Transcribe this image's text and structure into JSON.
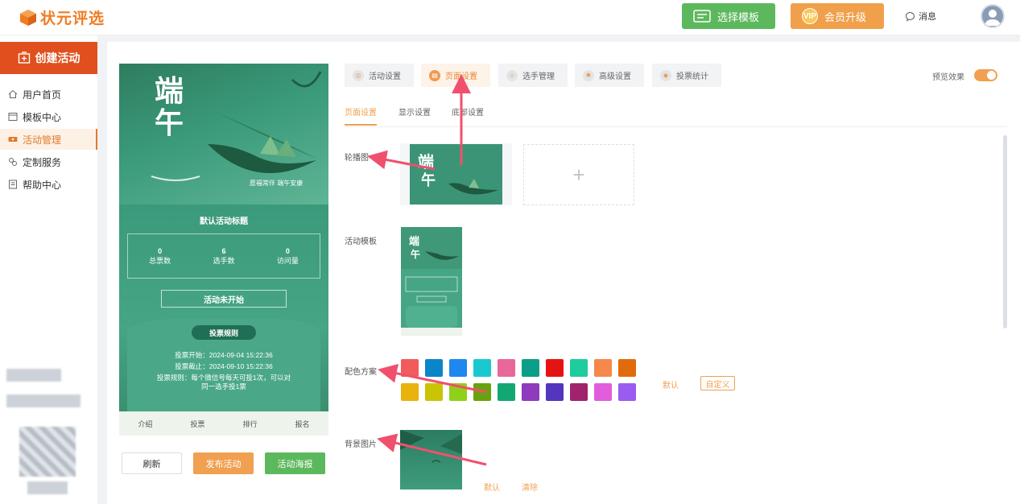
{
  "app": {
    "logo_text": "状元评选"
  },
  "topbar": {
    "select_template": "选择模板",
    "vip_badge": "VIP",
    "vip_upgrade": "会员升级",
    "messages": "消息"
  },
  "sidebar": {
    "create": "创建活动",
    "items": [
      {
        "label": "用户首页",
        "icon": "home-icon"
      },
      {
        "label": "模板中心",
        "icon": "template-icon"
      },
      {
        "label": "活动管理",
        "icon": "ticket-icon",
        "active": true
      },
      {
        "label": "定制服务",
        "icon": "custom-icon"
      },
      {
        "label": "帮助中心",
        "icon": "help-icon"
      }
    ]
  },
  "phone": {
    "calligraphy": "端午",
    "greeting": "愿福常伴 端午安康",
    "title": "默认活动标题",
    "stats": [
      {
        "value": "0",
        "label": "总票数"
      },
      {
        "value": "6",
        "label": "选手数"
      },
      {
        "value": "0",
        "label": "访问量"
      }
    ],
    "status": "活动未开始",
    "rules_title": "投票规则",
    "rules": [
      "投票开始：2024-09-04 15:22:36",
      "投票截止：2024-09-10 15:22:36",
      "投票规则：每个微信号每天可投1次，可以对",
      "同一选手投1票"
    ],
    "nav": [
      "介绍",
      "投票",
      "排行",
      "报名"
    ]
  },
  "actions": {
    "refresh": "刷新",
    "publish": "发布活动",
    "poster": "活动海报"
  },
  "tabs": [
    {
      "label": "活动设置",
      "active": false
    },
    {
      "label": "页面设置",
      "active": true
    },
    {
      "label": "选手管理",
      "active": false
    },
    {
      "label": "高级设置",
      "active": false
    },
    {
      "label": "投票统计",
      "active": false
    }
  ],
  "preview": {
    "label": "预览效果",
    "enabled": true
  },
  "subtabs": [
    {
      "label": "页面设置",
      "active": true
    },
    {
      "label": "显示设置",
      "active": false
    },
    {
      "label": "底部设置",
      "active": false
    }
  ],
  "form": {
    "carousel_label": "轮播图",
    "template_label": "活动模板",
    "scheme_label": "配色方案",
    "bg_label": "背景图片",
    "scheme_default": "默认",
    "scheme_custom": "自定义",
    "bg_default": "默认",
    "bg_clear": "清除",
    "upload_plus": "+"
  },
  "colors": [
    "#f25b5b",
    "#0a85c9",
    "#1e87f0",
    "#19c9cf",
    "#e9679a",
    "#0b9e88",
    "#e61313",
    "#1fcc9e",
    "#f5884a",
    "#e06b0d",
    "#e8b30e",
    "#c9c406",
    "#8fd11a",
    "#6aa10f",
    "#13a873",
    "#8e3bbd",
    "#5336bd",
    "#a0236d",
    "#e25ddb",
    "#9a5cf0"
  ]
}
